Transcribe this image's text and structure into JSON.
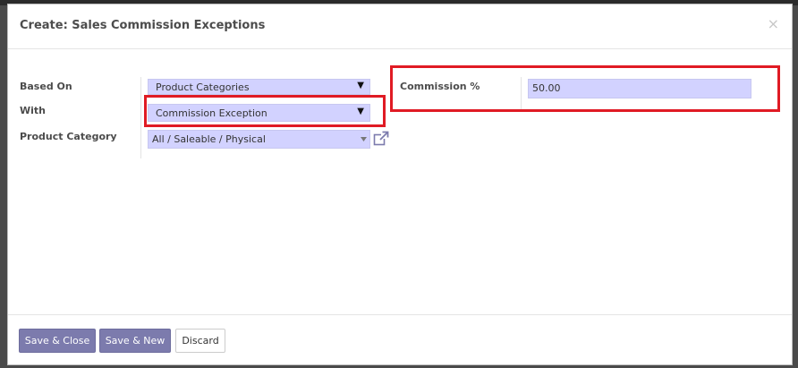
{
  "modal": {
    "title": "Create: Sales Commission Exceptions",
    "close_symbol": "×"
  },
  "form": {
    "based_on": {
      "label": "Based On",
      "value": "Product Categories"
    },
    "with": {
      "label": "With",
      "value": "Commission Exception"
    },
    "product_category": {
      "label": "Product Category",
      "value": "All / Saleable / Physical"
    },
    "commission_percent": {
      "label": "Commission %",
      "value": "50.00"
    }
  },
  "footer": {
    "save_close_label": "Save & Close",
    "save_new_label": "Save & New",
    "discard_label": "Discard"
  },
  "icons": {
    "select_arrow": "▼",
    "m2o_dropdown": "caret-down-icon",
    "external_link": "external-link-icon"
  },
  "colors": {
    "field_bg": "#d2d2ff",
    "primary_button": "#7c7bad",
    "highlight_red": "#e01b24"
  }
}
